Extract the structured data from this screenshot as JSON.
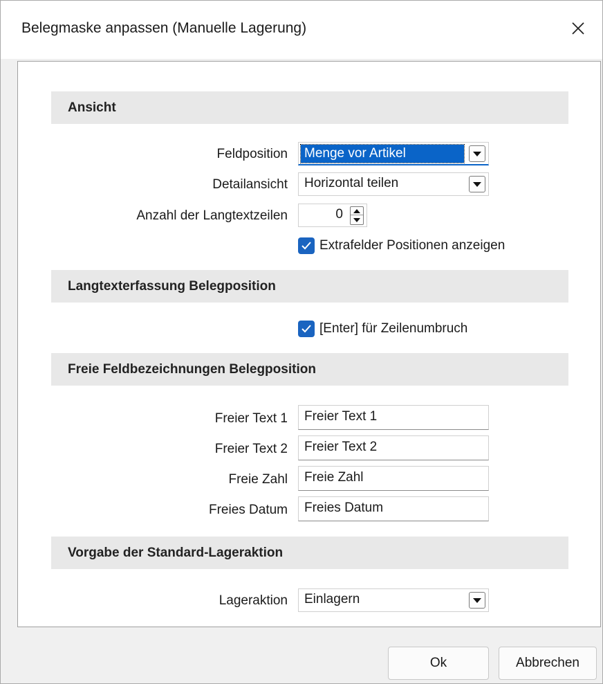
{
  "window": {
    "title": "Belegmaske anpassen (Manuelle Lagerung)"
  },
  "sections": {
    "ansicht": "Ansicht",
    "langtext": "Langtexterfassung Belegposition",
    "freie": "Freie Feldbezeichnungen Belegposition",
    "vorgabe": "Vorgabe der Standard-Lageraktion"
  },
  "ansicht": {
    "feldposition_label": "Feldposition",
    "feldposition_value": "Menge vor Artikel",
    "detailansicht_label": "Detailansicht",
    "detailansicht_value": "Horizontal teilen",
    "langtextzeilen_label": "Anzahl der Langtextzeilen",
    "langtextzeilen_value": "0",
    "extrafelder_label": "Extrafelder Positionen anzeigen",
    "extrafelder_checked": true
  },
  "langtext": {
    "enter_label": "[Enter] für Zeilenumbruch",
    "enter_checked": true
  },
  "freie": {
    "text1_label": "Freier Text 1",
    "text1_value": "Freier Text 1",
    "text2_label": "Freier Text 2",
    "text2_value": "Freier Text 2",
    "zahl_label": "Freie Zahl",
    "zahl_value": "Freie Zahl",
    "datum_label": "Freies Datum",
    "datum_value": "Freies Datum"
  },
  "vorgabe": {
    "lageraktion_label": "Lageraktion",
    "lageraktion_value": "Einlagern"
  },
  "buttons": {
    "ok": "Ok",
    "cancel": "Abbrechen"
  },
  "colors": {
    "accent": "#1a64c0",
    "selection": "#0a64c8",
    "section_bg": "#e8e8e8"
  }
}
